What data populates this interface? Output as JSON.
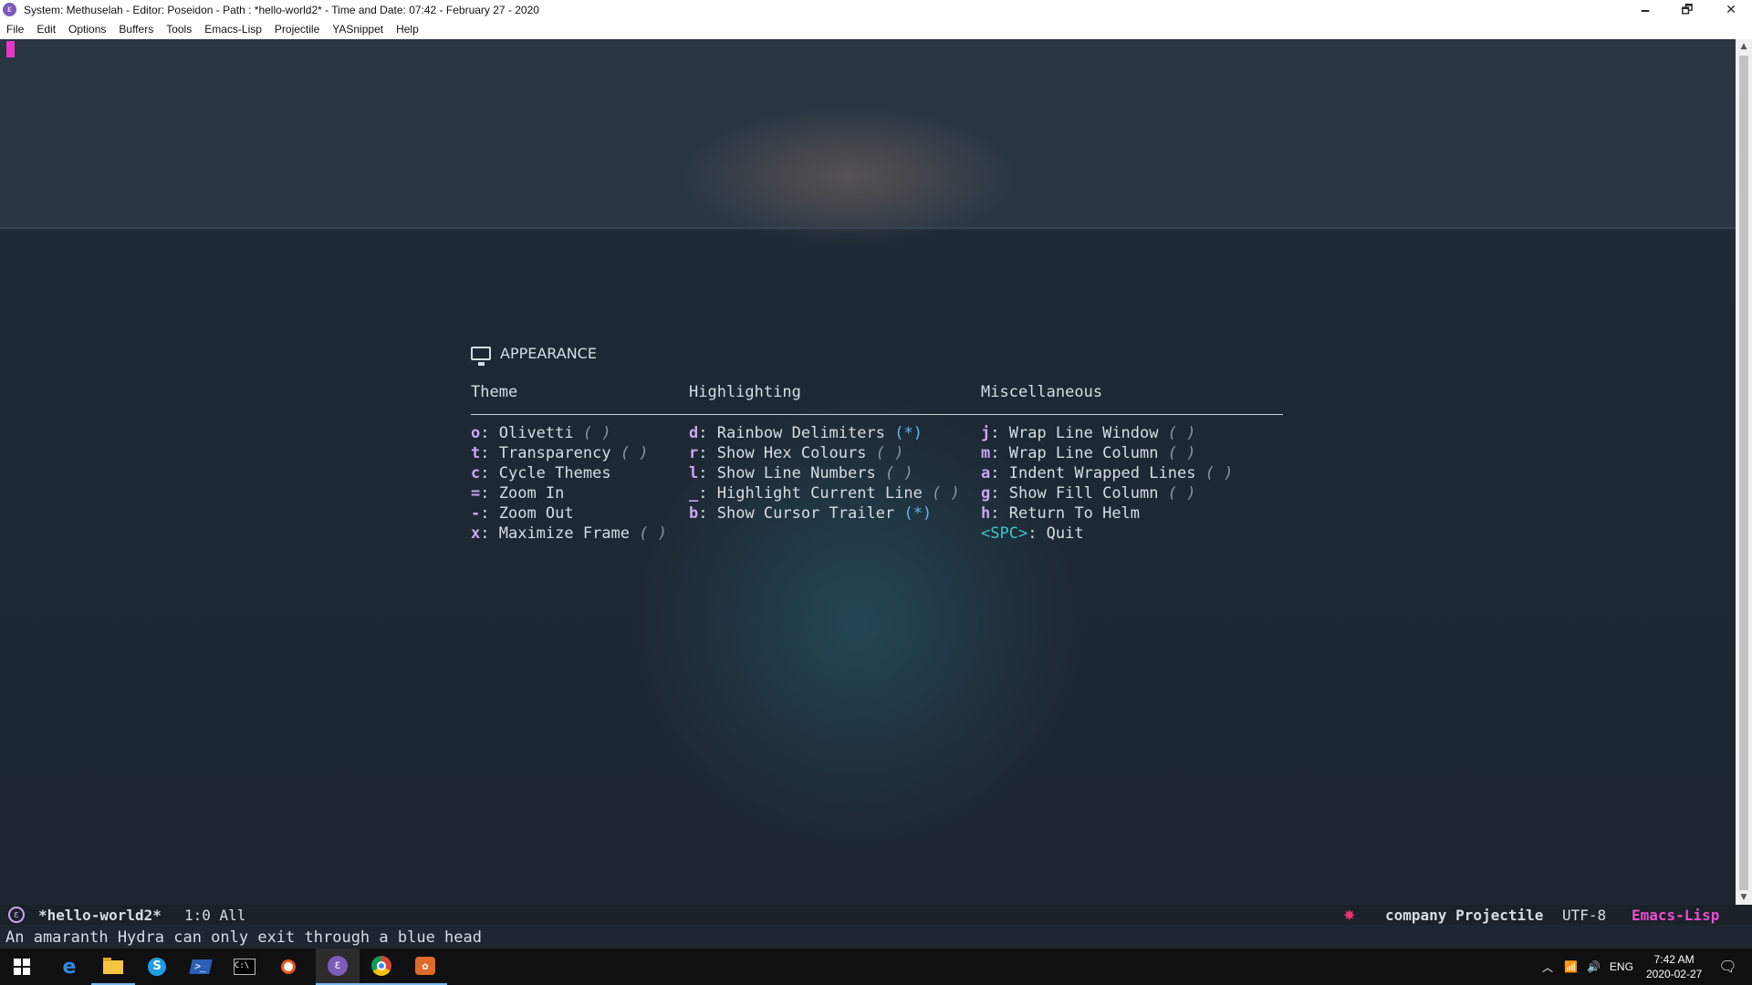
{
  "window": {
    "title": "System: Methuselah - Editor: Poseidon - Path : *hello-world2* - Time and Date: 07:42 - February 27 - 2020",
    "icon": "emacs-icon",
    "controls": {
      "minimize": "🗕",
      "restore": "🗗",
      "close": "✕"
    }
  },
  "menu": [
    "File",
    "Edit",
    "Options",
    "Buffers",
    "Tools",
    "Emacs-Lisp",
    "Projectile",
    "YASnippet",
    "Help"
  ],
  "hydra": {
    "title": "APPEARANCE",
    "columns": [
      {
        "heading": "Theme",
        "items": [
          {
            "key": "o",
            "label": "Olivetti",
            "state": "( )"
          },
          {
            "key": "t",
            "label": "Transparency",
            "state": "( )"
          },
          {
            "key": "c",
            "label": "Cycle Themes",
            "state": ""
          },
          {
            "key": "=",
            "label": "Zoom In",
            "state": ""
          },
          {
            "key": "-",
            "label": "Zoom Out",
            "state": ""
          },
          {
            "key": "x",
            "label": "Maximize Frame",
            "state": "( )"
          }
        ]
      },
      {
        "heading": "Highlighting",
        "items": [
          {
            "key": "d",
            "label": "Rainbow Delimiters",
            "state": "(*)"
          },
          {
            "key": "r",
            "label": "Show Hex Colours",
            "state": "( )"
          },
          {
            "key": "l",
            "label": "Show Line Numbers",
            "state": "( )"
          },
          {
            "key": "_",
            "label": "Highlight Current Line",
            "state": "( )"
          },
          {
            "key": "b",
            "label": "Show Cursor Trailer",
            "state": "(*)"
          }
        ]
      },
      {
        "heading": "Miscellaneous",
        "items": [
          {
            "key": "j",
            "label": "Wrap Line Window",
            "state": "( )"
          },
          {
            "key": "m",
            "label": "Wrap Line Column",
            "state": "( )"
          },
          {
            "key": "a",
            "label": "Indent Wrapped Lines",
            "state": "( )"
          },
          {
            "key": "g",
            "label": "Show Fill Column",
            "state": "( )"
          },
          {
            "key": "h",
            "label": "Return To Helm",
            "state": ""
          },
          {
            "key": "<SPC>",
            "label": "Quit",
            "state": ""
          }
        ]
      }
    ]
  },
  "modeline": {
    "buffer": "*hello-world2*",
    "position": "1:0 All",
    "bug_icon": "bug-icon",
    "minor_modes": "company Projectile",
    "encoding": "UTF-8",
    "major_mode": "Emacs-Lisp"
  },
  "echo": "An amaranth Hydra can only exit through a blue head",
  "taskbar": {
    "apps": [
      "windows-start-icon",
      "edge-icon",
      "file-explorer-icon",
      "skype-icon",
      "powershell-icon",
      "terminal-icon",
      "ubuntu-icon",
      "emacs-icon",
      "chrome-icon",
      "gimp-icon"
    ],
    "tray": {
      "language": "ENG",
      "time": "7:42 AM",
      "date": "2020-02-27"
    }
  },
  "colors": {
    "key": "#c9a7f2",
    "enabled_state": "#5fb6f0",
    "quit_key": "#3fc7c9",
    "major_mode": "#e84fd0",
    "cursor": "#e837c8"
  }
}
